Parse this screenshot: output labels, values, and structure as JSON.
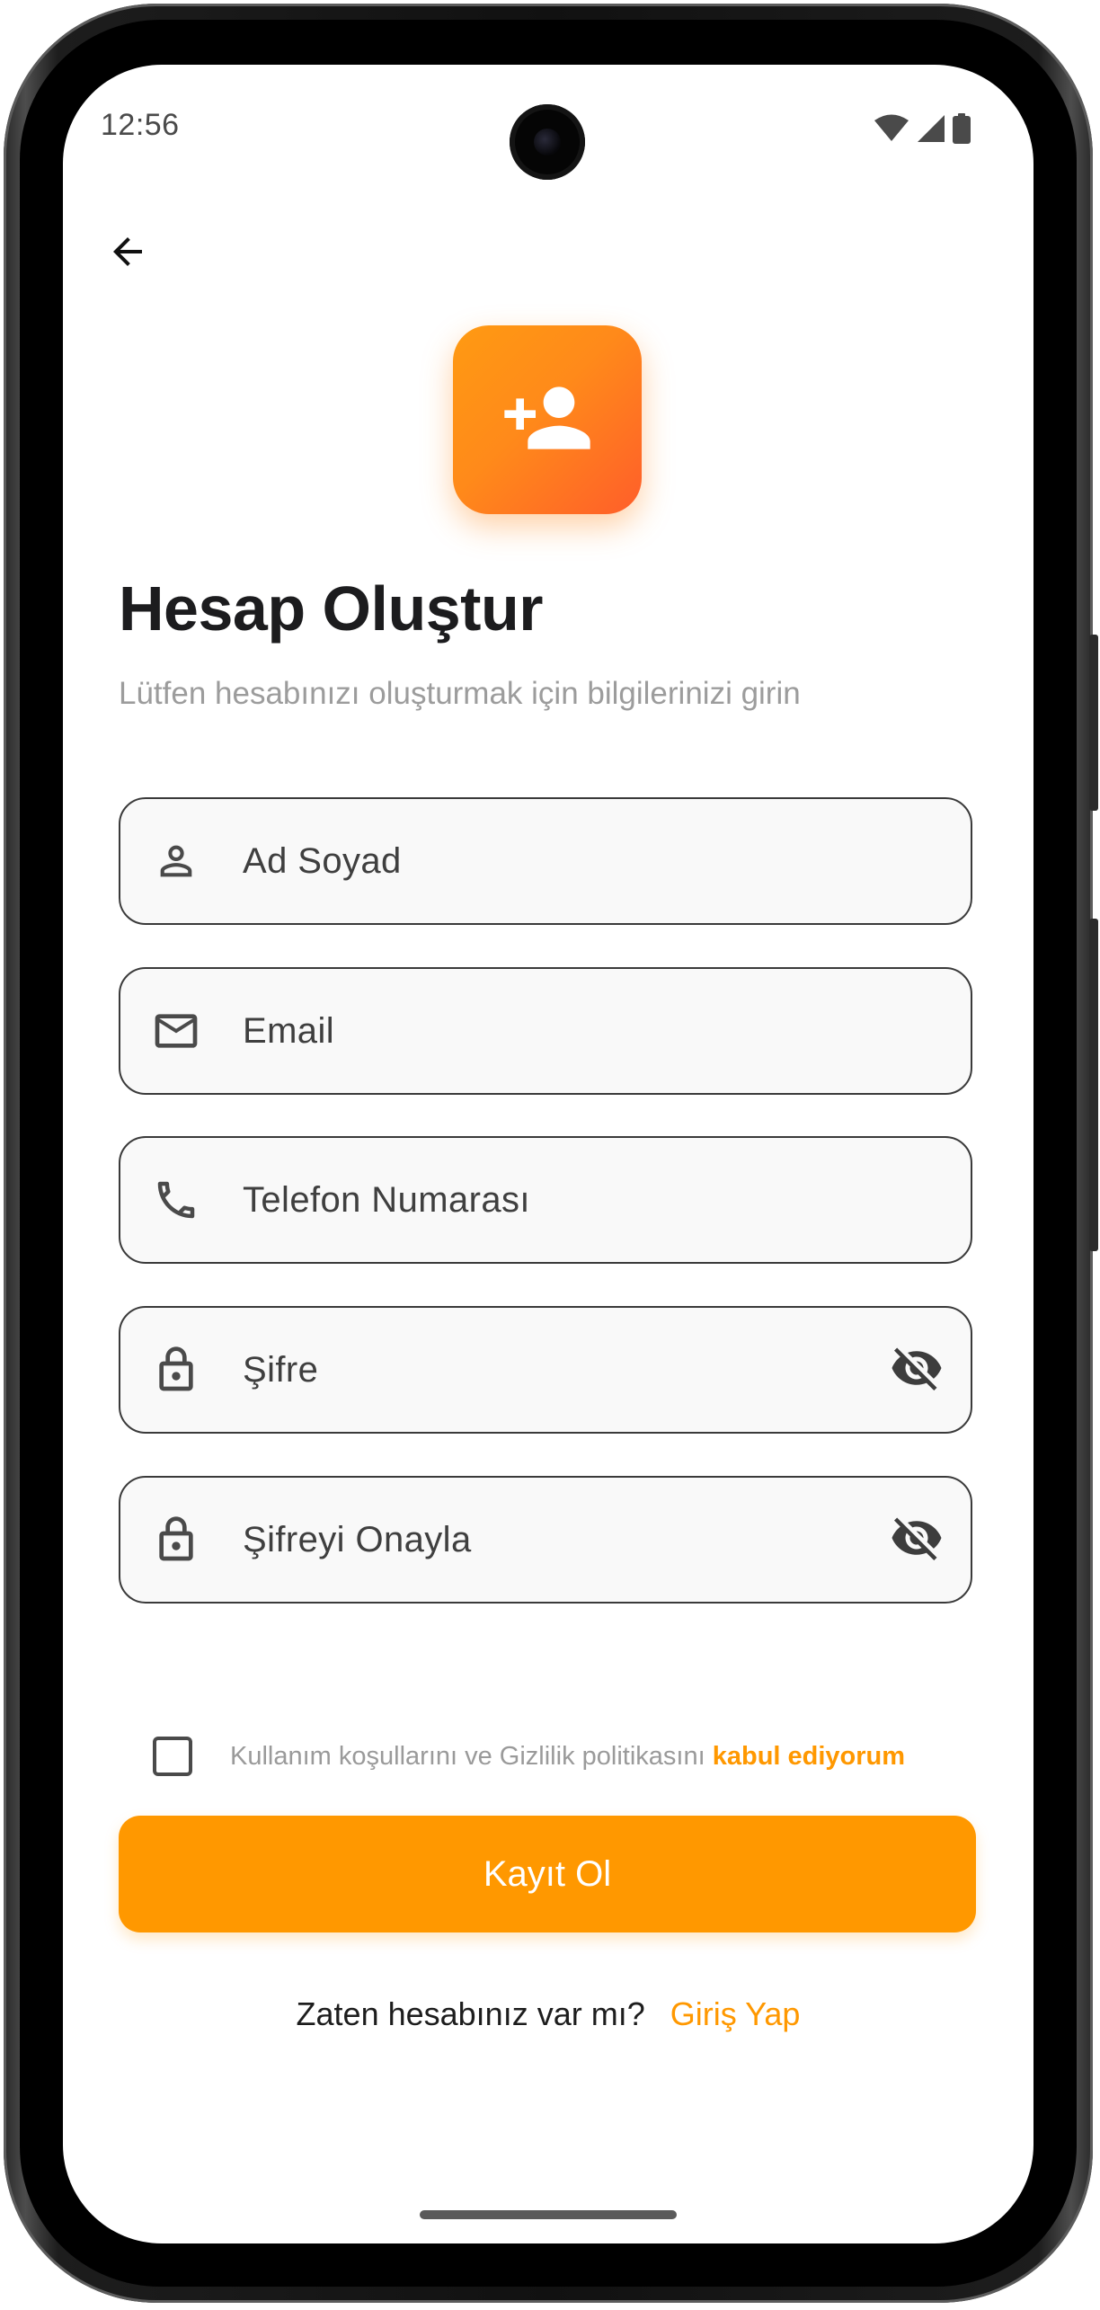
{
  "status_bar": {
    "time": "12:56",
    "icons": [
      "wifi-icon",
      "signal-icon",
      "battery-icon"
    ]
  },
  "header": {
    "back_icon": "arrow-left-icon",
    "logo_icon": "person-add-icon",
    "title": "Hesap Oluştur",
    "subtitle": "Lütfen hesabınızı oluşturmak için bilgilerinizi girin"
  },
  "form": {
    "fields": [
      {
        "placeholder": "Ad Soyad",
        "icon": "person-icon",
        "value": ""
      },
      {
        "placeholder": "Email",
        "icon": "mail-icon",
        "value": ""
      },
      {
        "placeholder": "Telefon Numarası",
        "icon": "phone-icon",
        "value": ""
      },
      {
        "placeholder": "Şifre",
        "icon": "lock-icon",
        "trailing_icon": "visibility-off-icon",
        "value": ""
      },
      {
        "placeholder": "Şifreyi Onayla",
        "icon": "lock-icon",
        "trailing_icon": "visibility-off-icon",
        "value": ""
      }
    ],
    "terms": {
      "checked": false,
      "text": "Kullanım koşullarını ve Gizlilik politikasını",
      "link": "kabul ediyorum"
    },
    "submit_label": "Kayıt Ol"
  },
  "footer": {
    "prompt": "Zaten hesabınız var mı?",
    "login_link": "Giriş Yap"
  },
  "colors": {
    "accent": "#FF9800",
    "logo_gradient_start": "#FF9A12",
    "logo_gradient_end": "#FF5E2A",
    "title": "#1C1C1E",
    "muted": "#9C9C9C",
    "field_bg": "#F9F9F9"
  }
}
